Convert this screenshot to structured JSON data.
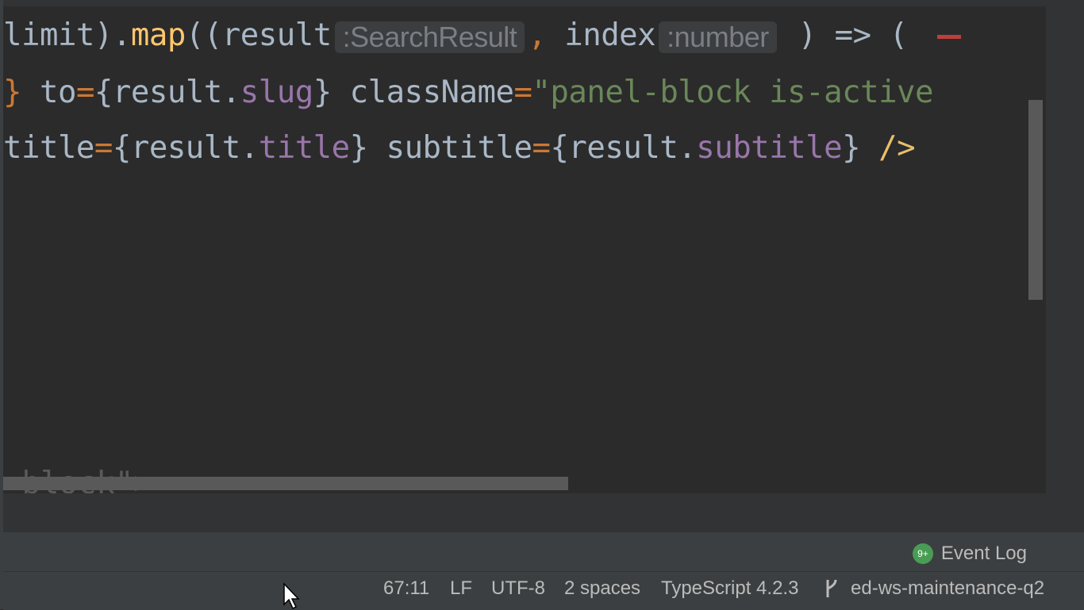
{
  "editor": {
    "line1": {
      "t1": "limit).",
      "fn": "map",
      "t2": "((result",
      "hint1": ":SearchResult",
      "comma": ",",
      "t3": " index",
      "hint2": ":number",
      "t4": " ) => ( "
    },
    "line2": {
      "t0": "} ",
      "attr1": "to",
      "eq1": "=",
      "t1": "{result.",
      "prop1": "slug",
      "t2": "} className",
      "eq2": "=",
      "str1": "\"panel-block is-active"
    },
    "line3": {
      "t1": "title",
      "eq1": "=",
      "t2": "{result.",
      "prop1": "title",
      "t3": "} subtitle",
      "eq2": "=",
      "t4": "{result.",
      "prop2": "subtitle",
      "t5": "} ",
      "close": "/>"
    },
    "faded": "-block\">"
  },
  "toolbar": {
    "event_log_label": "Event Log",
    "event_log_badge": "9+"
  },
  "status": {
    "position": "67:11",
    "line_sep": "LF",
    "encoding": "UTF-8",
    "indent": "2 spaces",
    "language": "TypeScript 4.2.3",
    "branch": "ed-ws-maintenance-q2"
  },
  "icons": {
    "branch": "git-branch-icon",
    "event": "event-log-icon",
    "cursor": "mouse-cursor-icon"
  },
  "colors": {
    "background": "#2b2b2b",
    "function": "#ffc66d",
    "string": "#6a8759",
    "property": "#9876aa",
    "keyword": "#cc7832",
    "status_bg": "#3c3f41",
    "error": "#bc3f3c"
  }
}
